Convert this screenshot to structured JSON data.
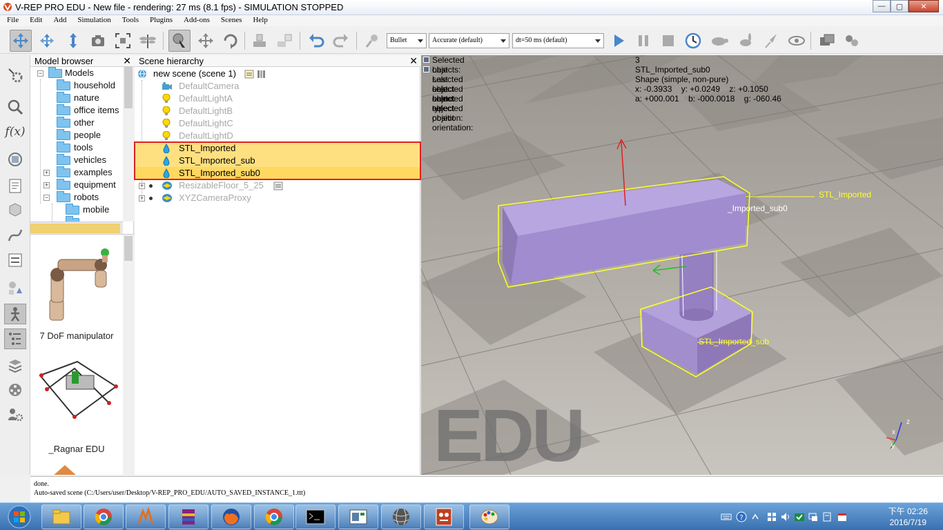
{
  "window": {
    "title": "V-REP PRO EDU - New file - rendering: 27 ms (8.1 fps) - SIMULATION STOPPED",
    "buttons": {
      "minimize": "—",
      "maximize": "▢",
      "close": "✕"
    }
  },
  "menu": [
    "File",
    "Edit",
    "Add",
    "Simulation",
    "Tools",
    "Plugins",
    "Add-ons",
    "Scenes",
    "Help"
  ],
  "toolbar": {
    "engine": "Bullet",
    "accuracy": "Accurate (default)",
    "timestep": "dt=50 ms (default)",
    "icons": [
      "camera-pan-icon",
      "camera-rotate-icon",
      "camera-shift-icon",
      "camera-angle-icon",
      "fit-to-view-icon",
      "dragonfly-icon",
      "object-select-icon",
      "object-shift-icon",
      "object-rotate-icon",
      "assemble-icon",
      "disassemble-icon",
      "undo-icon",
      "redo-icon",
      "dynamics-toggle-icon",
      "play-icon",
      "pause-icon",
      "stop-icon",
      "realtime-icon",
      "slow-down-icon",
      "speed-up-icon",
      "thread-rendering-icon",
      "visualization-toggle-icon",
      "page-selector-icon",
      "scene-selector-icon"
    ]
  },
  "model_browser": {
    "title": "Model browser",
    "close": "✕",
    "tree": [
      {
        "label": "Models",
        "level": 0,
        "expander": "−"
      },
      {
        "label": "household",
        "level": 1,
        "expander": ""
      },
      {
        "label": "nature",
        "level": 1,
        "expander": ""
      },
      {
        "label": "office items",
        "level": 1,
        "expander": ""
      },
      {
        "label": "other",
        "level": 1,
        "expander": ""
      },
      {
        "label": "people",
        "level": 1,
        "expander": ""
      },
      {
        "label": "tools",
        "level": 1,
        "expander": ""
      },
      {
        "label": "vehicles",
        "level": 1,
        "expander": ""
      },
      {
        "label": "examples",
        "level": 1,
        "expander": "+"
      },
      {
        "label": "equipment",
        "level": 1,
        "expander": "+"
      },
      {
        "label": "robots",
        "level": 1,
        "expander": "−"
      },
      {
        "label": "mobile",
        "level": 2,
        "expander": ""
      }
    ],
    "thumbnails": [
      {
        "label": "7 DoF manipulator"
      },
      {
        "label": "_Ragnar EDU"
      }
    ]
  },
  "scene_hierarchy": {
    "title": "Scene hierarchy",
    "close": "✕",
    "root": "new scene (scene 1)",
    "items": [
      {
        "label": "DefaultCamera",
        "icon": "camera-icon",
        "state": "dim"
      },
      {
        "label": "DefaultLightA",
        "icon": "light-icon",
        "state": "dim"
      },
      {
        "label": "DefaultLightB",
        "icon": "light-icon",
        "state": "dim"
      },
      {
        "label": "DefaultLightC",
        "icon": "light-icon",
        "state": "dim"
      },
      {
        "label": "DefaultLightD",
        "icon": "light-icon",
        "state": "dim"
      },
      {
        "label": "STL_Imported",
        "icon": "shape-icon",
        "state": "selected"
      },
      {
        "label": "STL_Imported_sub",
        "icon": "shape-icon",
        "state": "selected"
      },
      {
        "label": "STL_Imported_sub0",
        "icon": "shape-icon",
        "state": "last-selected"
      },
      {
        "label": "ResizableFloor_5_25",
        "icon": "floor-icon",
        "state": "dim"
      },
      {
        "label": "XYZCameraProxy",
        "icon": "floor-icon",
        "state": "dim"
      }
    ]
  },
  "selection_info": {
    "rows": [
      {
        "key": "Selected objects:",
        "value": "3"
      },
      {
        "key": "Last selected object name:",
        "value": "STL_Imported_sub0"
      },
      {
        "key": "Last selected object type:",
        "value": "Shape (simple, non-pure)"
      },
      {
        "key": "Last selected object position:",
        "value": "x: -0.3933    y: +0.0249    z: +0.1050"
      },
      {
        "key": "Last selected object orientation:",
        "value": "a: +000.001    b: -000.0018    g: -060.46"
      }
    ]
  },
  "viewport": {
    "watermark": "EDU",
    "labels": {
      "stl_imported": "STL_Imported",
      "stl_imported_sub0": "_Imported_sub0",
      "stl_imported_sub": "STL_Imported_sub"
    },
    "axes": {
      "x": "x",
      "y": "y",
      "z": "z"
    },
    "colors": {
      "object": "#a48ccc",
      "selection": "#ffff30",
      "floor": "#b5b1ab"
    }
  },
  "status": {
    "lines": [
      "done.",
      "Auto-saved scene (C:/Users/user/Desktop/V-REP_PRO_EDU/AUTO_SAVED_INSTANCE_1.ttt)"
    ]
  },
  "taskbar": {
    "apps": [
      "file-explorer-icon",
      "chrome-icon",
      "vrep-icon",
      "winrar-icon",
      "firefox-icon",
      "chrome-icon",
      "command-prompt-icon",
      "remote-desktop-icon",
      "sphere-app-icon",
      "vrep-edu-icon",
      "paint-icon"
    ],
    "time": "下午 02:26",
    "date": "2016/7/19"
  }
}
